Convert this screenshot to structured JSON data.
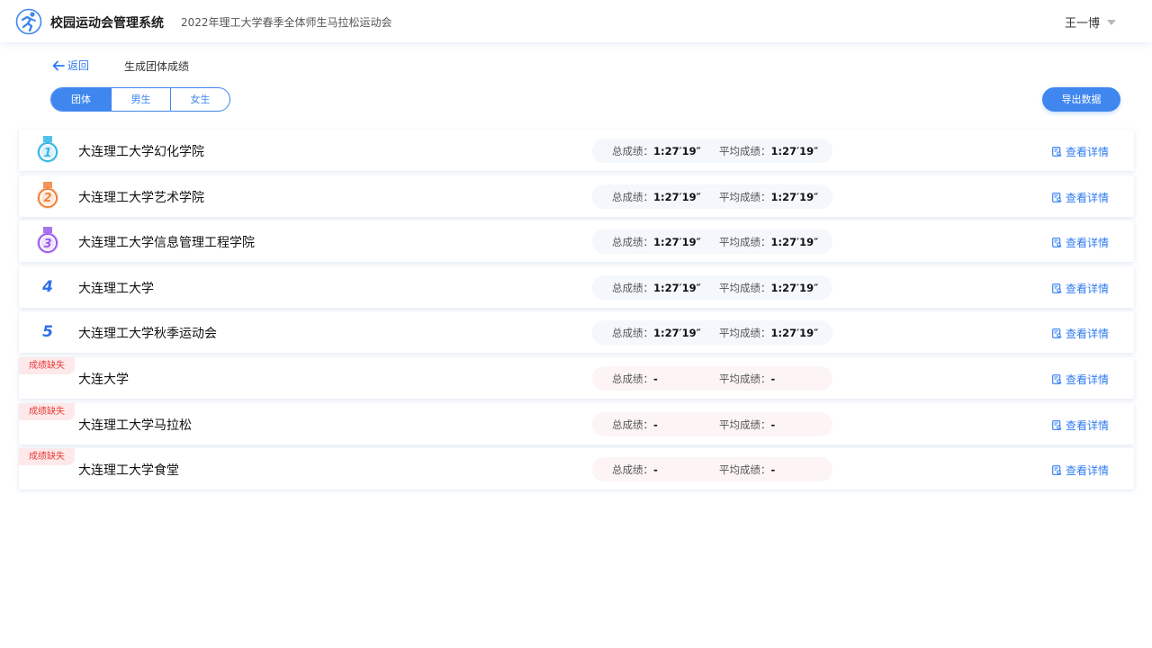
{
  "header": {
    "app_title": "校园运动会管理系统",
    "event_title": "2022年理工大学春季全体师生马拉松运动会",
    "user_name": "王一博"
  },
  "subheader": {
    "back_label": "返回",
    "page_title": "生成团体成绩"
  },
  "tabs": [
    {
      "label": "团体",
      "active": true
    },
    {
      "label": "男生",
      "active": false
    },
    {
      "label": "女生",
      "active": false
    }
  ],
  "export_label": "导出数据",
  "labels": {
    "total": "总成绩：",
    "avg": "平均成绩：",
    "detail": "查看详情",
    "missing": "成绩缺失"
  },
  "colors": {
    "accent": "#3f86ee",
    "missing": "#ea3b3b",
    "medal_1": "#34b6e6",
    "medal_2": "#f0823a",
    "medal_3": "#9a5ce8"
  },
  "rows": [
    {
      "rank": "1",
      "medal": "medal-1-icon",
      "name": "大连理工大学幻化学院",
      "total": "1:27′19″",
      "avg": "1:27′19″",
      "missing": false
    },
    {
      "rank": "2",
      "medal": "medal-2-icon",
      "name": "大连理工大学艺术学院",
      "total": "1:27′19″",
      "avg": "1:27′19″",
      "missing": false
    },
    {
      "rank": "3",
      "medal": "medal-3-icon",
      "name": "大连理工大学信息管理工程学院",
      "total": "1:27′19″",
      "avg": "1:27′19″",
      "missing": false
    },
    {
      "rank": "4",
      "medal": null,
      "name": "大连理工大学",
      "total": "1:27′19″",
      "avg": "1:27′19″",
      "missing": false
    },
    {
      "rank": "5",
      "medal": null,
      "name": "大连理工大学秋季运动会",
      "total": "1:27′19″",
      "avg": "1:27′19″",
      "missing": false
    },
    {
      "rank": null,
      "medal": null,
      "name": "大连大学",
      "total": "-",
      "avg": "-",
      "missing": true
    },
    {
      "rank": null,
      "medal": null,
      "name": "大连理工大学马拉松",
      "total": "-",
      "avg": "-",
      "missing": true
    },
    {
      "rank": null,
      "medal": null,
      "name": "大连理工大学食堂",
      "total": "-",
      "avg": "-",
      "missing": true
    }
  ]
}
